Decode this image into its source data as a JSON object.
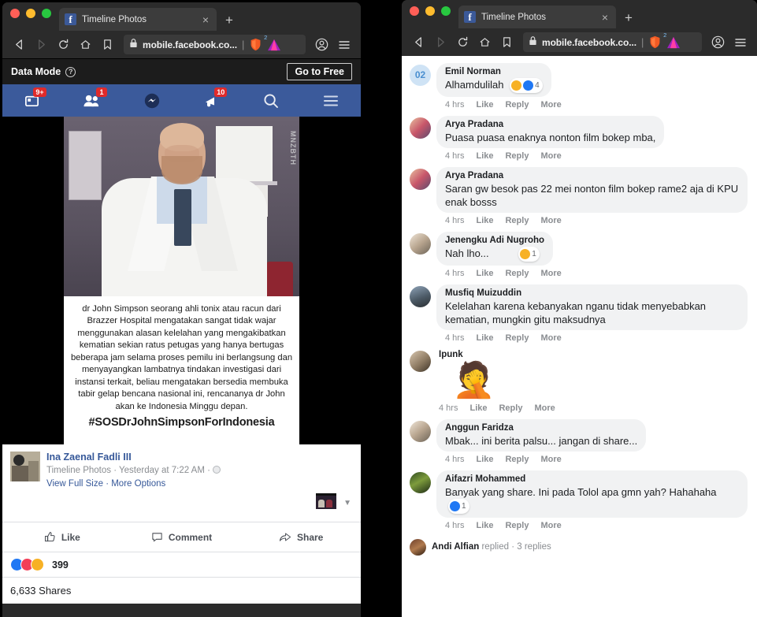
{
  "browser": {
    "tab_title": "Timeline Photos",
    "url": "mobile.facebook.co...",
    "brave_badge": "2",
    "icons": {
      "back": "back-arrow-icon",
      "forward": "forward-arrow-icon",
      "reload": "reload-icon",
      "home": "home-icon",
      "bookmark": "bookmark-icon",
      "lock": "lock-icon",
      "brave_shield": "brave-shield-icon",
      "brave_logo": "brave-logo-icon",
      "profile": "profile-icon",
      "menu": "hamburger-menu-icon",
      "new_tab": "+",
      "close_tab": "×"
    }
  },
  "data_mode": {
    "label": "Data Mode",
    "help": "?",
    "button": "Go to Free"
  },
  "fbnav": [
    {
      "name": "news-feed",
      "badge": "9+"
    },
    {
      "name": "friend-requests",
      "badge": "1"
    },
    {
      "name": "messenger",
      "badge": ""
    },
    {
      "name": "notifications",
      "badge": "10"
    },
    {
      "name": "search",
      "badge": ""
    },
    {
      "name": "main-menu",
      "badge": ""
    }
  ],
  "post": {
    "watermark": "MNZBTH",
    "image_text": "dr John Simpson seorang ahli tonix atau racun dari Brazzer Hospital mengatakan sangat tidak wajar menggunakan alasan kelelahan yang mengakibatkan kematian sekian ratus petugas yang hanya bertugas beberapa jam selama proses pemilu ini berlangsung dan menyayangkan lambatnya tindakan investigasi dari instansi terkait, beliau mengatakan bersedia membuka tabir gelap bencana nasional ini, rencananya dr John akan ke Indonesia Minggu depan.",
    "image_hashtag": "#SOSDrJohnSimpsonForIndonesia",
    "author": "Ina Zaenal Fadli III",
    "meta": "Timeline Photos · Yesterday at 7:22 AM ·",
    "links": "View Full Size · More Options",
    "actions": {
      "like": "Like",
      "comment": "Comment",
      "share": "Share"
    },
    "reaction_count": "399",
    "shares": "6,633 Shares"
  },
  "comments": [
    {
      "avatar": "02",
      "avatar_kind": "number",
      "name": "Emil Norman",
      "text": "Alhamdulilah",
      "reaction_emoji": "haha+care",
      "reaction_count": "4",
      "meta": {
        "time": "4 hrs",
        "like": "Like",
        "reply": "Reply",
        "more": "More"
      }
    },
    {
      "avatar_kind": "ava-b",
      "name": "Arya Pradana",
      "text": "Puasa puasa enaknya nonton film bokep mba,",
      "reaction_emoji": "",
      "reaction_count": "",
      "meta": {
        "time": "4 hrs",
        "like": "Like",
        "reply": "Reply",
        "more": "More"
      }
    },
    {
      "avatar_kind": "ava-b",
      "name": "Arya Pradana",
      "text": "Saran gw besok pas 22 mei nonton film bokep rame2 aja di KPU enak bosss",
      "reaction_emoji": "",
      "reaction_count": "",
      "meta": {
        "time": "4 hrs",
        "like": "Like",
        "reply": "Reply",
        "more": "More"
      }
    },
    {
      "avatar_kind": "ava-d",
      "name": "Jenengku Adi Nugroho",
      "text": "Nah lho...",
      "reaction_emoji": "haha",
      "reaction_count": "1",
      "meta": {
        "time": "4 hrs",
        "like": "Like",
        "reply": "Reply",
        "more": "More"
      }
    },
    {
      "avatar_kind": "ava-c",
      "name": "Musfiq Muizuddin",
      "text": "Kelelahan karena kebanyakan nganu tidak menyebabkan kematian, mungkin gitu maksudnya",
      "reaction_emoji": "",
      "reaction_count": "",
      "meta": {
        "time": "4 hrs",
        "like": "Like",
        "reply": "Reply",
        "more": "More"
      }
    },
    {
      "avatar_kind": "ava-g",
      "name": "Ipunk",
      "text": "",
      "sticker": "🤦",
      "reaction_emoji": "",
      "reaction_count": "",
      "meta": {
        "time": "4 hrs",
        "like": "Like",
        "reply": "Reply",
        "more": "More"
      }
    },
    {
      "avatar_kind": "ava-d",
      "name": "Anggun Faridza",
      "text": "Mbak... ini berita palsu... jangan di share...",
      "reaction_emoji": "",
      "reaction_count": "",
      "meta": {
        "time": "4 hrs",
        "like": "Like",
        "reply": "Reply",
        "more": "More"
      }
    },
    {
      "avatar_kind": "ava-e",
      "name": "Aifazri Mohammed",
      "text": "Banyak yang share. Ini pada Tolol apa gmn yah? Hahahaha",
      "reaction_emoji": "like",
      "reaction_count": "1",
      "meta": {
        "time": "4 hrs",
        "like": "Like",
        "reply": "Reply",
        "more": "More"
      }
    }
  ],
  "replied": {
    "name": "Andi Alfian",
    "verb": "replied",
    "sep": "·",
    "count": "3 replies"
  },
  "colors": {
    "fb_blue": "#3b5a9b",
    "link_blue": "#365899",
    "badge_red": "#e02a2a",
    "bubble_gray": "#f1f2f3"
  }
}
